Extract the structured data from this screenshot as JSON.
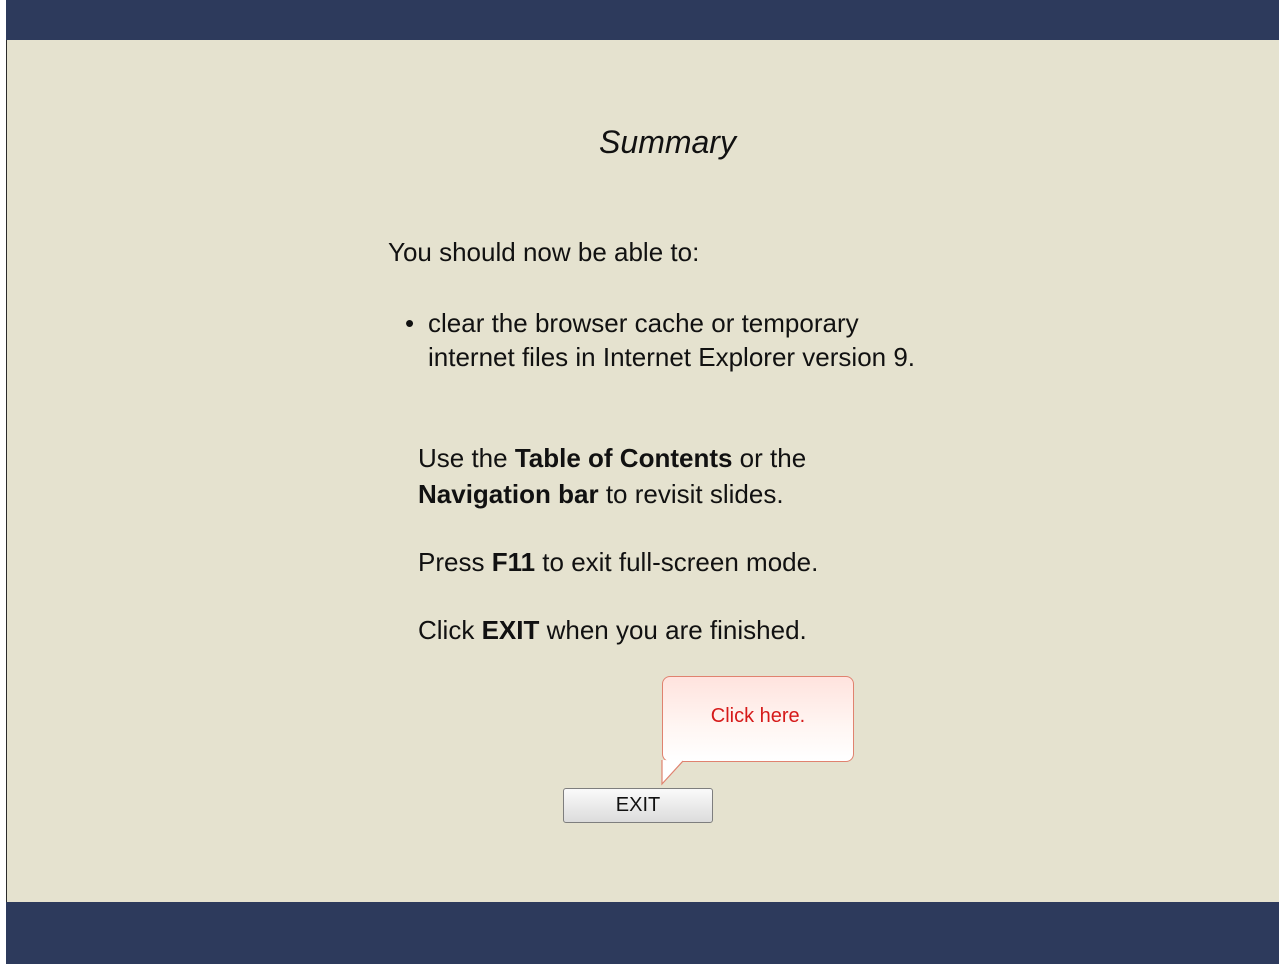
{
  "slide": {
    "title": "Summary",
    "intro": "You should now be able to:",
    "bullets": [
      "clear the browser cache or temporary internet files in Internet Explorer version 9."
    ],
    "paragraph1": {
      "part1": "Use the ",
      "bold1": "Table of Contents",
      "part2": " or the ",
      "bold2": "Navigation bar",
      "part3": " to revisit slides."
    },
    "paragraph2": {
      "part1": "Press ",
      "bold1": "F11",
      "part2": " to exit full-screen mode."
    },
    "paragraph3": {
      "part1": "Click ",
      "bold1": "EXIT",
      "part2": " when you are finished."
    }
  },
  "callout": {
    "text": "Click here."
  },
  "exit_button": {
    "label": "EXIT"
  },
  "colors": {
    "bar": "#2d3a5c",
    "background": "#e5e2cf",
    "callout_text": "#d61a1a",
    "callout_border": "#e0826f"
  }
}
